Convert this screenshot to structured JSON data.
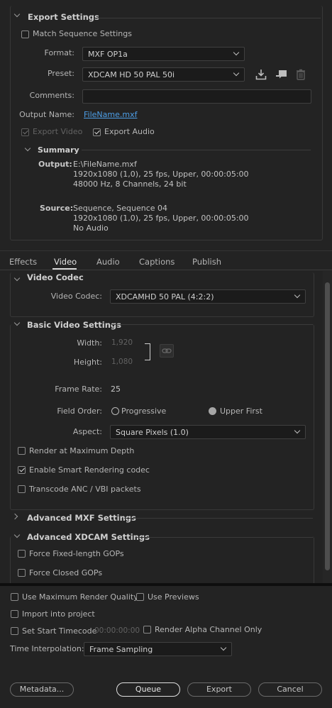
{
  "export_settings": {
    "title": "Export Settings",
    "match_sequence_label": "Match Sequence Settings",
    "match_sequence_checked": false,
    "format_label": "Format:",
    "format_value": "MXF OP1a",
    "preset_label": "Preset:",
    "preset_value": "XDCAM HD 50 PAL 50i",
    "comments_label": "Comments:",
    "comments_value": "",
    "output_name_label": "Output Name:",
    "output_name_value": "FileName.mxf",
    "export_video_label": "Export Video",
    "export_video_checked": true,
    "export_audio_label": "Export Audio",
    "export_audio_checked": true,
    "icons": [
      "save-preset-icon",
      "import-preset-icon",
      "delete-preset-icon"
    ]
  },
  "summary": {
    "title": "Summary",
    "output_label": "Output:",
    "output_lines": [
      "E:\\FileName.mxf",
      "1920x1080 (1,0), 25 fps, Upper, 00:00:05:00",
      "48000 Hz, 8 Channels, 24 bit"
    ],
    "source_label": "Source:",
    "source_lines": [
      "Sequence, Sequence 04",
      "1920x1080 (1,0), 25 fps, Upper, 00:00:05:00",
      "No Audio"
    ]
  },
  "tabs": [
    {
      "label": "Effects",
      "active": false
    },
    {
      "label": "Video",
      "active": true
    },
    {
      "label": "Audio",
      "active": false
    },
    {
      "label": "Captions",
      "active": false
    },
    {
      "label": "Publish",
      "active": false
    }
  ],
  "video_codec": {
    "title": "Video Codec",
    "label": "Video Codec:",
    "value": "XDCAMHD 50 PAL (4:2:2)"
  },
  "basic_video": {
    "title": "Basic Video Settings",
    "width_label": "Width:",
    "width_value": "1,920",
    "height_label": "Height:",
    "height_value": "1,080",
    "frame_rate_label": "Frame Rate:",
    "frame_rate_value": "25",
    "field_order_label": "Field Order:",
    "field_order_options": [
      "Progressive",
      "Upper First"
    ],
    "field_order_selected": "Upper First",
    "aspect_label": "Aspect:",
    "aspect_value": "Square Pixels (1.0)",
    "render_max_depth_label": "Render at Maximum Depth",
    "render_max_depth_checked": false,
    "smart_rendering_label": "Enable Smart Rendering codec",
    "smart_rendering_checked": true,
    "transcode_anc_label": "Transcode ANC / VBI packets",
    "transcode_anc_checked": false
  },
  "advanced_mxf": {
    "title": "Advanced MXF Settings",
    "expanded": false
  },
  "advanced_xdcam": {
    "title": "Advanced XDCAM Settings",
    "expanded": true,
    "force_fixed_label": "Force Fixed-length GOPs",
    "force_fixed_checked": false,
    "force_closed_label": "Force Closed GOPs",
    "force_closed_checked": false
  },
  "bottom": {
    "max_render_quality_label": "Use Maximum Render Quality",
    "use_previews_label": "Use Previews",
    "import_project_label": "Import into project",
    "set_start_timecode_label": "Set Start Timecode",
    "start_timecode_value": "00:00:00:00",
    "render_alpha_label": "Render Alpha Channel Only",
    "time_interp_label": "Time Interpolation:",
    "time_interp_value": "Frame Sampling"
  },
  "buttons": {
    "metadata": "Metadata...",
    "queue": "Queue",
    "export": "Export",
    "cancel": "Cancel"
  },
  "colors": {
    "background": "#232323",
    "link": "#4d9fe8",
    "border": "#383838"
  }
}
